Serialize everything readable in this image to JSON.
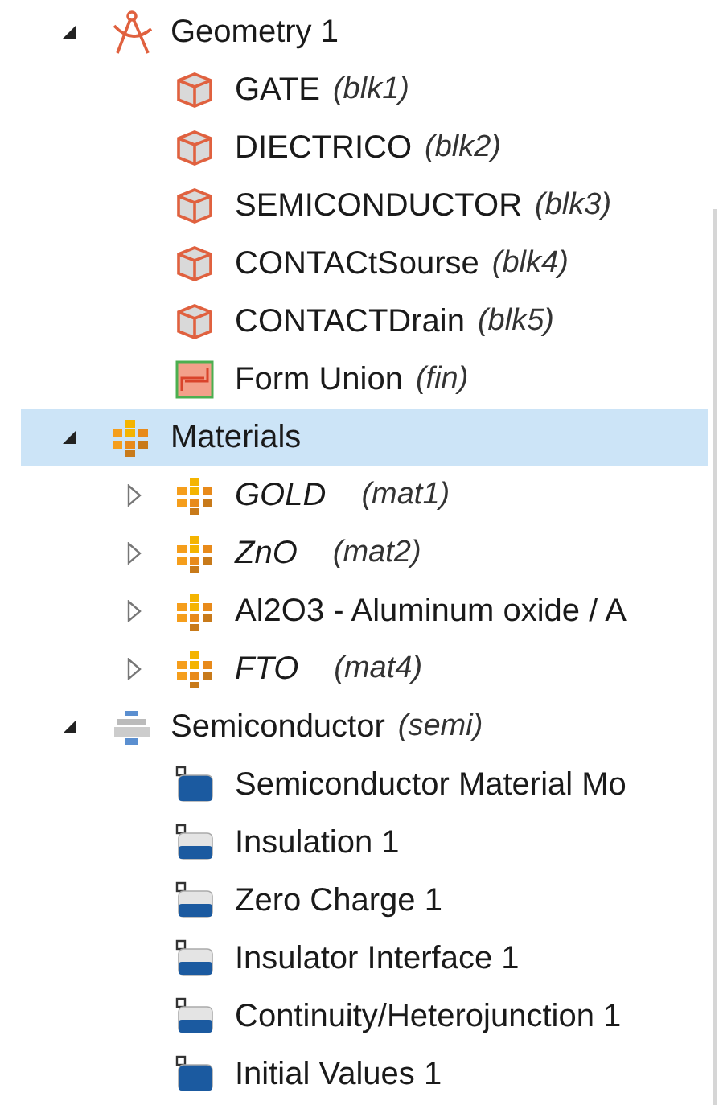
{
  "tree": [
    {
      "label": "Geometry 1",
      "kind": "geometry",
      "expanded": true,
      "selected": false,
      "children": [
        {
          "label": "GATE",
          "tag": "(blk1)",
          "kind": "block",
          "selected": false
        },
        {
          "label": "DIECTRICO",
          "tag": "(blk2)",
          "kind": "block",
          "selected": false
        },
        {
          "label": "SEMICONDUCTOR",
          "tag": "(blk3)",
          "kind": "block",
          "selected": false
        },
        {
          "label": "CONTACtSourse",
          "tag": "(blk4)",
          "kind": "block",
          "selected": false
        },
        {
          "label": "CONTACTDrain",
          "tag": "(blk5)",
          "kind": "block",
          "selected": false
        },
        {
          "label": "Form Union",
          "tag": "(fin)",
          "kind": "union",
          "selected": false
        }
      ]
    },
    {
      "label": "Materials",
      "kind": "material",
      "expanded": true,
      "selected": true,
      "children": [
        {
          "label": "GOLD",
          "tag": "(mat1)",
          "kind": "material",
          "italic": true,
          "expanded": false,
          "selected": false
        },
        {
          "label": "ZnO",
          "tag": "(mat2)",
          "kind": "material",
          "italic": true,
          "expanded": false,
          "selected": false
        },
        {
          "label": "Al2O3 - Aluminum oxide / A",
          "kind": "material",
          "italic": false,
          "expanded": false,
          "selected": false
        },
        {
          "label": "FTO",
          "tag": "(mat4)",
          "kind": "material",
          "italic": true,
          "expanded": false,
          "selected": false
        }
      ]
    },
    {
      "label": "Semiconductor",
      "tag": "(semi)",
      "kind": "physics",
      "expanded": true,
      "selected": false,
      "children": [
        {
          "label": "Semiconductor Material Mo",
          "kind": "domain",
          "selected": false
        },
        {
          "label": "Insulation 1",
          "kind": "boundary",
          "selected": false
        },
        {
          "label": "Zero Charge 1",
          "kind": "boundary",
          "selected": false
        },
        {
          "label": "Insulator Interface 1",
          "kind": "boundary",
          "selected": false
        },
        {
          "label": "Continuity/Heterojunction 1",
          "kind": "boundary",
          "selected": false
        },
        {
          "label": "Initial Values 1",
          "kind": "domain",
          "selected": false
        }
      ]
    }
  ]
}
